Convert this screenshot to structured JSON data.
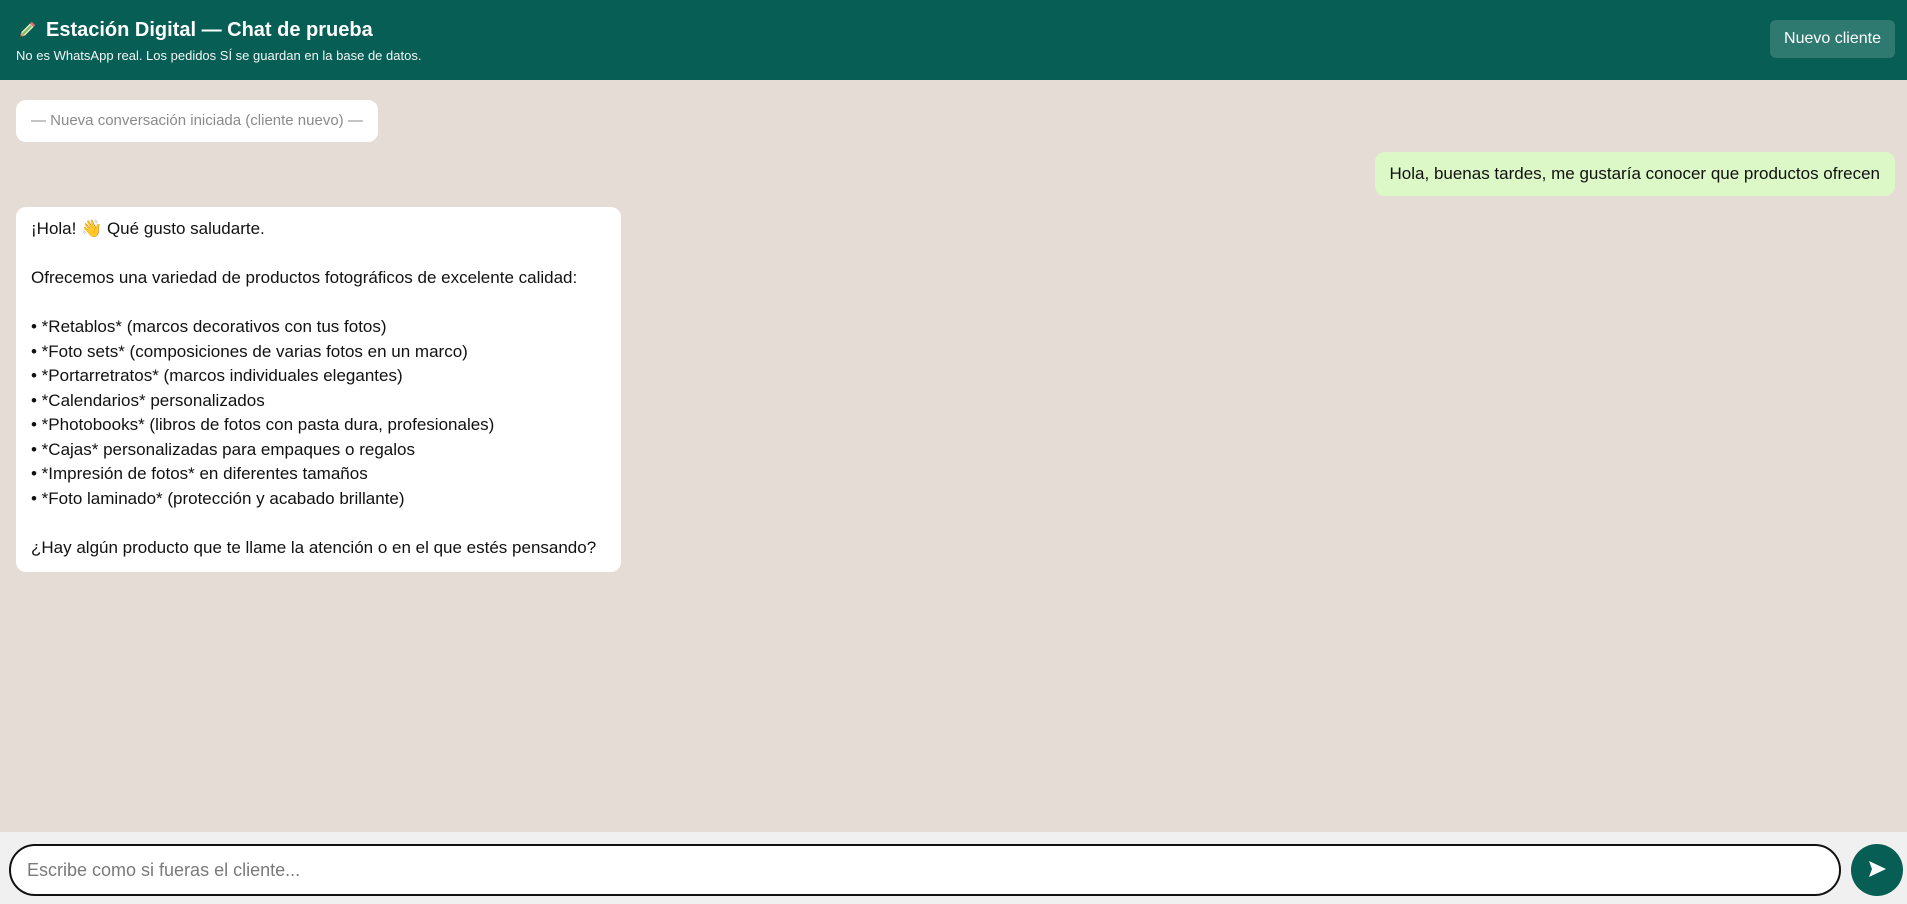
{
  "header": {
    "title": "Estación Digital — Chat de prueba",
    "subtitle": "No es WhatsApp real. Los pedidos SÍ se guardan en la base de datos.",
    "title_icon": "pencil-icon",
    "new_client_label": "Nuevo cliente"
  },
  "chat": {
    "system_message": "— Nueva conversación iniciada (cliente nuevo) —",
    "outgoing_message": "Hola, buenas tardes, me gustaría conocer que productos ofrecen",
    "incoming_message": "¡Hola! 👋 Qué gusto saludarte.\n\nOfrecemos una variedad de productos fotográficos de excelente calidad:\n\n• *Retablos* (marcos decorativos con tus fotos)\n• *Foto sets* (composiciones de varias fotos en un marco)\n• *Portarretratos* (marcos individuales elegantes)\n• *Calendarios* personalizados\n• *Photobooks* (libros de fotos con pasta dura, profesionales)\n• *Cajas* personalizadas para empaques o regalos\n• *Impresión de fotos* en diferentes tamaños\n• *Foto laminado* (protección y acabado brillante)\n\n¿Hay algún producto que te llame la atención o en el que estés pensando?"
  },
  "composer": {
    "placeholder": "Escribe como si fueras el cliente...",
    "send_icon": "send-icon"
  },
  "colors": {
    "header_bg": "#075e54",
    "chat_bg": "#e5ddd5",
    "outgoing_bubble": "#dcf8c6",
    "incoming_bubble": "#ffffff"
  }
}
